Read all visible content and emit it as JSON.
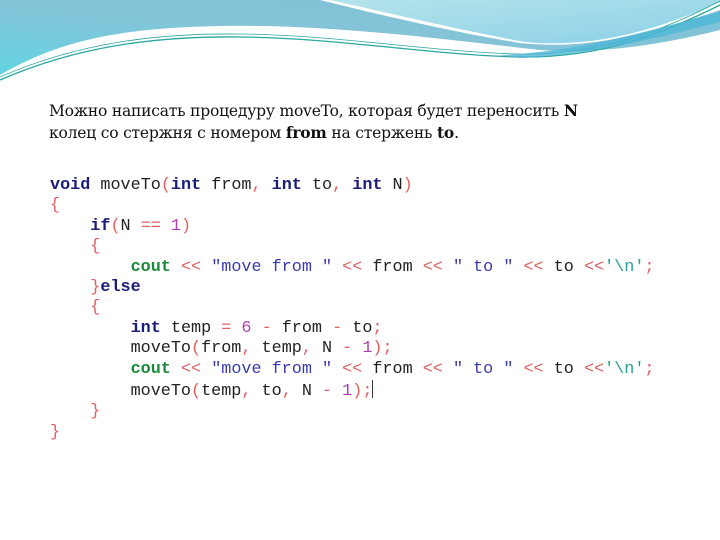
{
  "description": {
    "line1_prefix": "Можно написать процедуру  moveTo, которая будет переносить ",
    "line1_bold": "N",
    "line2_prefix": "колец со стержня с номером ",
    "line2_bold1": "from",
    "line2_mid": " на стержень ",
    "line2_bold2": "to",
    "line2_suffix": "."
  },
  "code": {
    "language": "C++",
    "lines": [
      "void moveTo(int from, int to, int N)",
      "{",
      "    if(N == 1)",
      "    {",
      "        cout << \"move from \" << from << \" to \" << to <<'\\n';",
      "    }else",
      "    {",
      "        int temp = 6 - from - to;",
      "        moveTo(from, temp, N - 1);",
      "        cout << \"move from \" << from << \" to \" << to <<'\\n';",
      "        moveTo(temp, to, N - 1);",
      "    }",
      "}"
    ],
    "tokens": {
      "void": "void",
      "fname": "moveTo",
      "int": "int",
      "from": "from",
      "to": "to",
      "N": "N",
      "if": "if",
      "one": "1",
      "eq": "==",
      "cout": "cout",
      "shl": "<<",
      "str_move": "\"move from \"",
      "str_to": "\" to \"",
      "nl": "'\\n'",
      "else": "else",
      "temp": "temp",
      "six": "6",
      "minus": "-"
    }
  },
  "colors": {
    "keyword": "#1c1c7a",
    "brace_operator": "#e06060",
    "number": "#b040b0",
    "string": "#3b3bb0",
    "cout": "#1a8a3a",
    "header_teal": "#5cc8d8"
  }
}
